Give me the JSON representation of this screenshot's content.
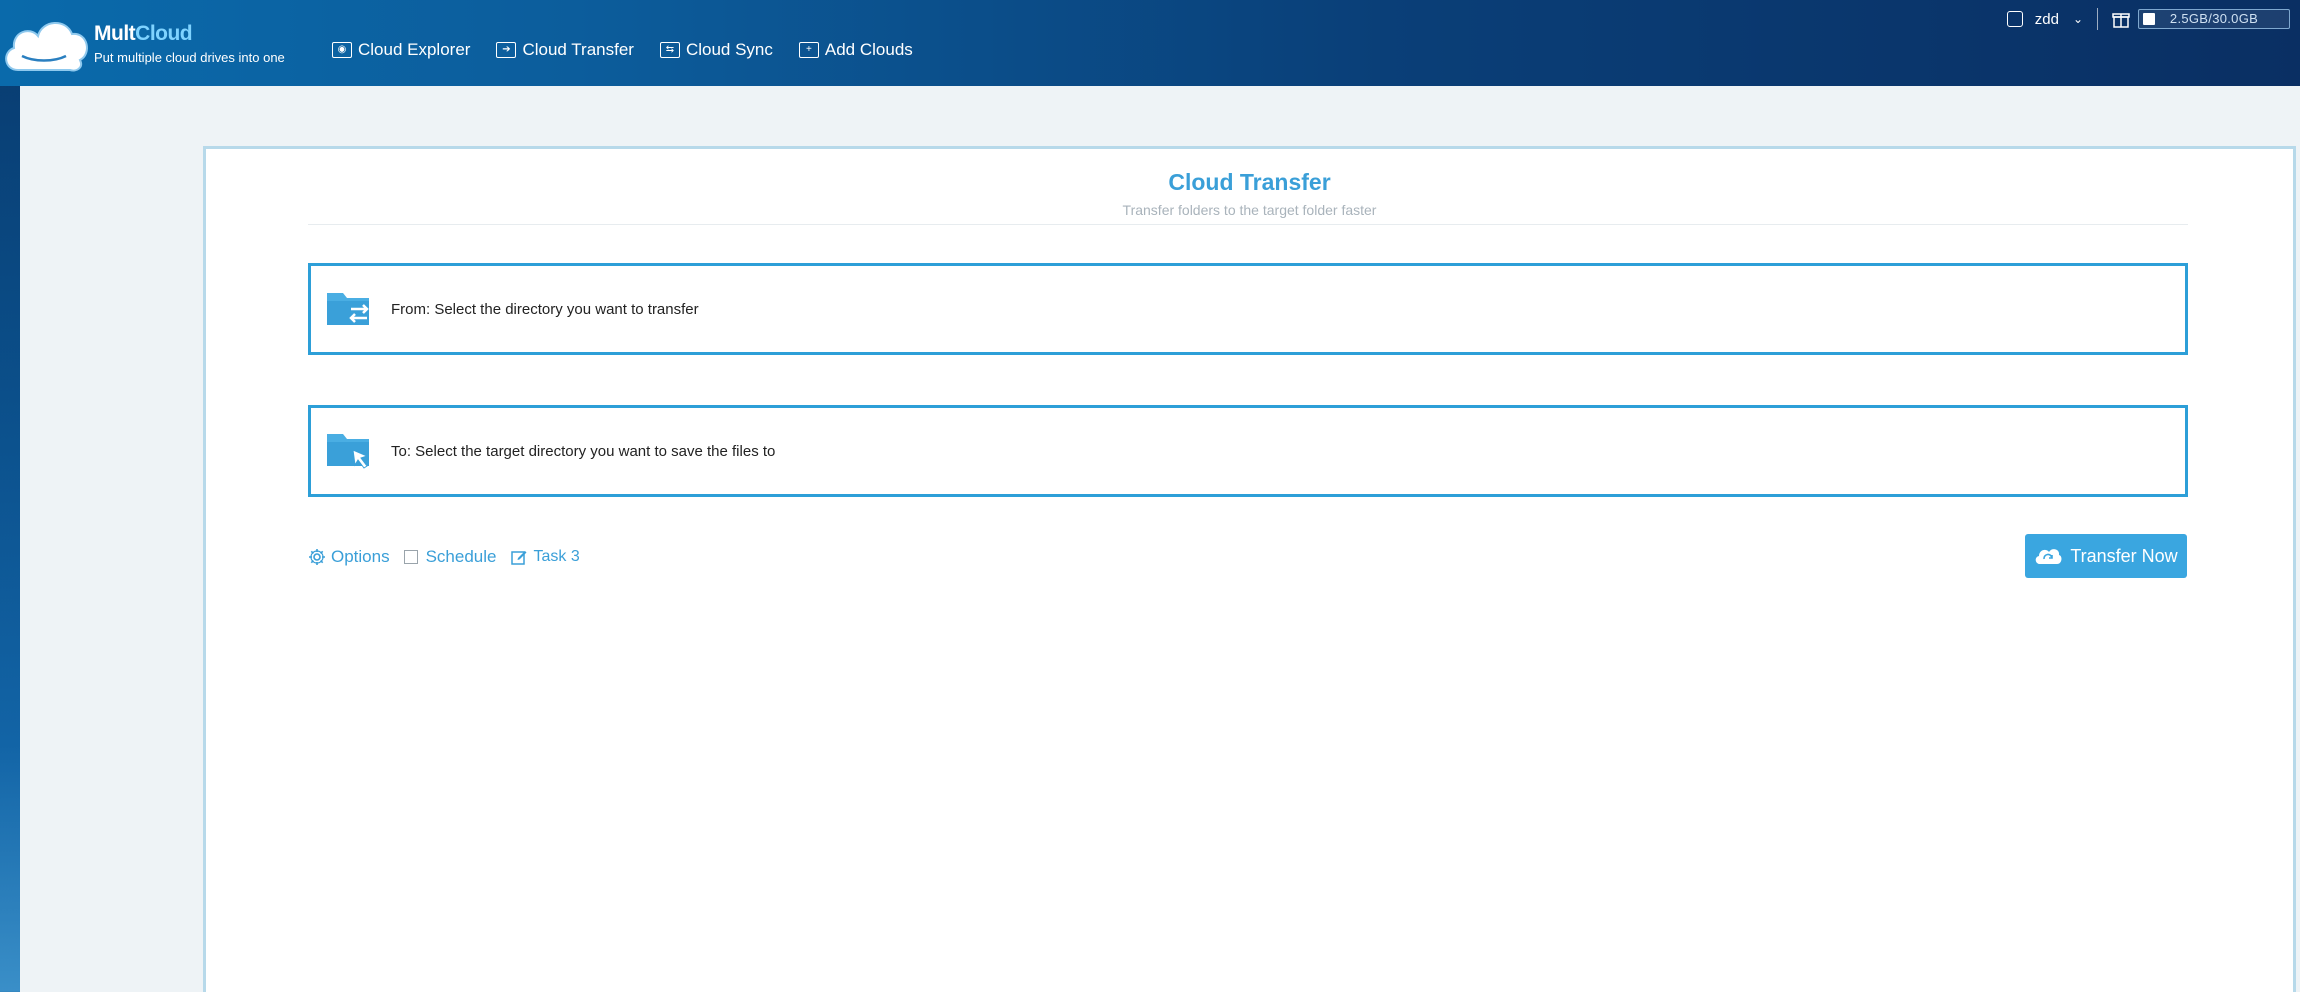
{
  "brand": {
    "name_part1": "Mult",
    "name_part2": "Cloud",
    "tagline": "Put multiple cloud drives into one"
  },
  "nav": {
    "items": [
      {
        "label": "Cloud Explorer",
        "icon": "explorer-icon"
      },
      {
        "label": "Cloud Transfer",
        "icon": "transfer-icon"
      },
      {
        "label": "Cloud Sync",
        "icon": "sync-icon"
      },
      {
        "label": "Add Clouds",
        "icon": "add-icon"
      }
    ]
  },
  "user": {
    "name": "zdd",
    "storage_text": "2.5GB/30.0GB",
    "storage_used_fraction": 0.083
  },
  "page": {
    "title": "Cloud Transfer",
    "subtitle": "Transfer folders to the target folder faster",
    "from_label": "From: Select the directory you want to transfer",
    "to_label": "To: Select the target directory you want to save the files to",
    "options_label": "Options",
    "schedule_label": "Schedule",
    "task_label": "Task 3",
    "transfer_button": "Transfer Now"
  },
  "colors": {
    "accent": "#3a9fd8",
    "button": "#3aa6e0",
    "header": "#0a3f78"
  }
}
